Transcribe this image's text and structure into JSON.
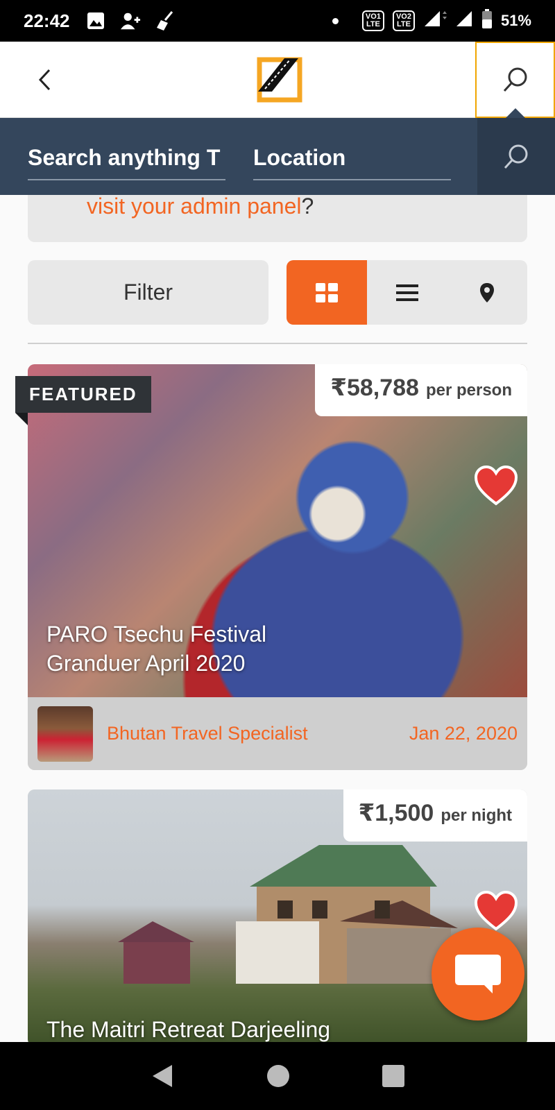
{
  "status_bar": {
    "time": "22:42",
    "battery": "51%",
    "volte1": "VO1",
    "volte1_sub": "LTE",
    "volte2": "VO2",
    "volte2_sub": "LTE"
  },
  "header": {
    "logo": "app-logo"
  },
  "search": {
    "keyword_value": "Search anything T",
    "location_value": "Location"
  },
  "notice": {
    "link_text": "visit your admin panel",
    "suffix": "?"
  },
  "filters": {
    "filter_label": "Filter",
    "views": [
      "grid",
      "list",
      "map"
    ],
    "active_view": "grid"
  },
  "listings": [
    {
      "badge": "FEATURED",
      "price": "₹58,788",
      "price_unit": "per person",
      "title_line1": "PARO Tsechu Festival",
      "title_line2": "Granduer April 2020",
      "author": "Bhutan Travel Specialist",
      "date": "Jan 22, 2020",
      "favorite": true
    },
    {
      "price": "₹1,500",
      "price_unit": "per night",
      "title": "The Maitri Retreat Darjeeling",
      "favorite": true
    }
  ],
  "colors": {
    "accent": "#f26522",
    "search_bg": "#34465c",
    "badge_bg": "#2f3337",
    "heart": "#e53935"
  }
}
